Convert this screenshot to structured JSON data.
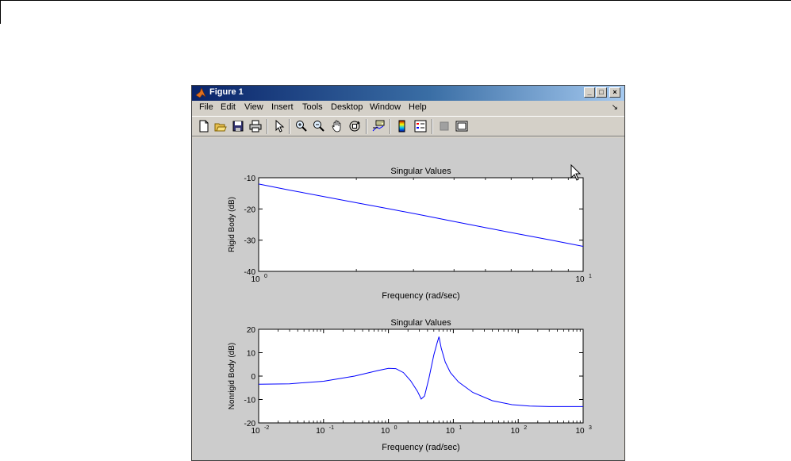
{
  "window": {
    "title": "Figure 1",
    "min_label": "_",
    "max_label": "□",
    "close_label": "×"
  },
  "menu": {
    "items": [
      "File",
      "Edit",
      "View",
      "Insert",
      "Tools",
      "Desktop",
      "Window",
      "Help"
    ],
    "dock_arrow": "↘"
  },
  "toolbar": {
    "icons": [
      "new-figure-icon",
      "open-file-icon",
      "save-icon",
      "print-icon",
      "edit-plot-arrow-icon",
      "zoom-in-icon",
      "zoom-out-icon",
      "pan-hand-icon",
      "rotate-3d-icon",
      "data-cursor-icon",
      "colorbar-icon",
      "legend-icon",
      "hide-plot-tools-icon",
      "show-plot-tools-icon"
    ]
  },
  "chart_data": [
    {
      "type": "line",
      "title": "Singular Values",
      "xlabel": "Frequency (rad/sec)",
      "ylabel": "Rigid Body (dB)",
      "xscale": "log",
      "xlim": [
        1,
        10
      ],
      "ylim": [
        -40,
        -10
      ],
      "xticks": [
        {
          "base": "10",
          "exp": "0"
        },
        {
          "base": "10",
          "exp": "1"
        }
      ],
      "yticks": [
        "-10",
        "-20",
        "-30",
        "-40"
      ],
      "grid": false,
      "color": "#0000ff",
      "x": [
        1,
        1.25,
        1.6,
        2,
        2.5,
        3.2,
        4,
        5,
        6.3,
        8,
        10
      ],
      "values": [
        -12,
        -14,
        -16.1,
        -18,
        -19.9,
        -22,
        -24,
        -26,
        -28,
        -30,
        -32
      ]
    },
    {
      "type": "line",
      "title": "Singular Values",
      "xlabel": "Frequency (rad/sec)",
      "ylabel": "Nonrigid Body (dB)",
      "xscale": "log",
      "xlim": [
        0.01,
        1000
      ],
      "ylim": [
        -20,
        20
      ],
      "xticks": [
        {
          "base": "10",
          "exp": "-2"
        },
        {
          "base": "10",
          "exp": "-1"
        },
        {
          "base": "10",
          "exp": "0"
        },
        {
          "base": "10",
          "exp": "1"
        },
        {
          "base": "10",
          "exp": "2"
        },
        {
          "base": "10",
          "exp": "3"
        }
      ],
      "yticks": [
        "20",
        "10",
        "0",
        "-10",
        "-20"
      ],
      "grid": false,
      "color": "#0000ff",
      "x": [
        0.01,
        0.03,
        0.1,
        0.3,
        0.7,
        1.0,
        1.3,
        1.7,
        2.2,
        2.8,
        3.2,
        3.6,
        4.2,
        5.0,
        5.6,
        6.0,
        6.5,
        7.5,
        9,
        12,
        20,
        40,
        80,
        150,
        300,
        1000
      ],
      "values": [
        -3.5,
        -3.3,
        -2.2,
        0,
        2.4,
        3.3,
        3.2,
        1.5,
        -2,
        -6.5,
        -9.8,
        -8.5,
        -1,
        9,
        14,
        16.8,
        12,
        6,
        1.5,
        -2.5,
        -7,
        -10.5,
        -12.2,
        -12.8,
        -13,
        -13
      ]
    }
  ]
}
